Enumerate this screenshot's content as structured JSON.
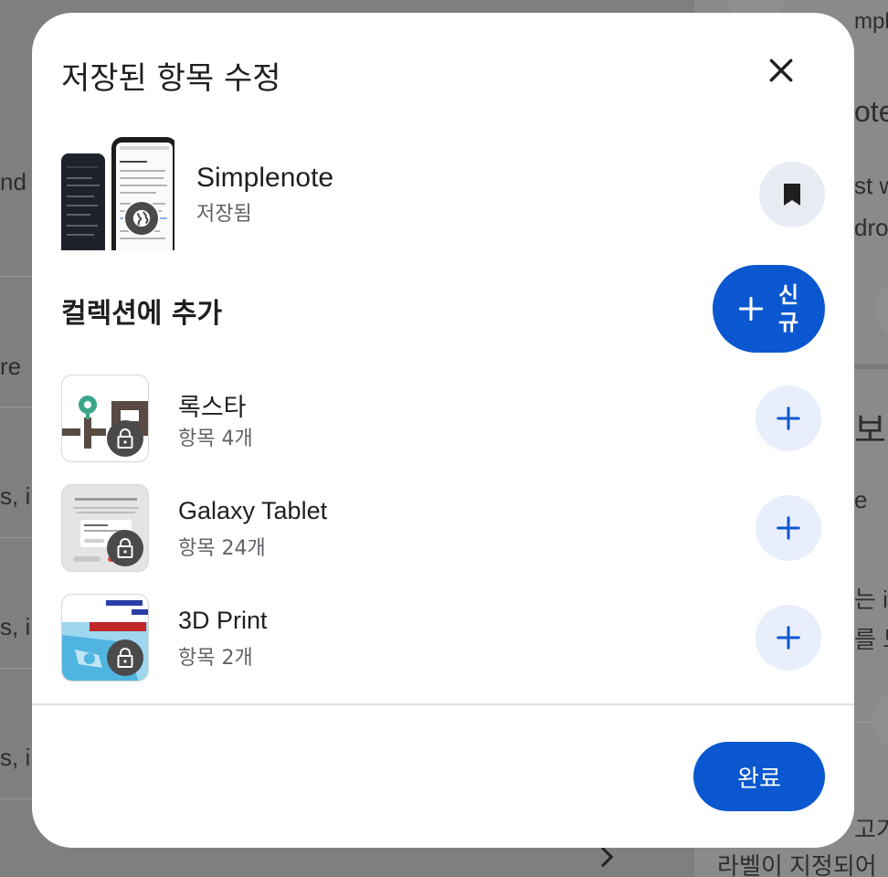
{
  "background": {
    "left_fragments": [
      "nd f",
      "re",
      "s, i",
      "s, i",
      "s, i"
    ],
    "right_fragments": [
      "mple",
      "ote",
      "st w",
      "droi",
      "보",
      "e",
      "는 i",
      "를 도",
      "고가",
      "라벨이 지정되어"
    ]
  },
  "dialog": {
    "title": "저장된 항목 수정",
    "close_icon": "close-icon"
  },
  "saved_item": {
    "name": "Simplenote",
    "status": "저장됨",
    "badge_icon": "globe-icon",
    "action_icon": "bookmark-filled-icon"
  },
  "collections_section": {
    "title": "컬렉션에 추가",
    "new_button_label": "신규"
  },
  "collections": [
    {
      "name": "록스타",
      "count": "항목 4개",
      "locked": true
    },
    {
      "name": "Galaxy Tablet",
      "count": "항목 24개",
      "locked": true
    },
    {
      "name": "3D Print",
      "count": "항목 2개",
      "locked": true
    }
  ],
  "footer": {
    "done_label": "완료"
  },
  "colors": {
    "primary": "#0b57d0",
    "tonal": "#e8eefb",
    "text": "#1f1f1f",
    "secondary_text": "#5f6368"
  }
}
